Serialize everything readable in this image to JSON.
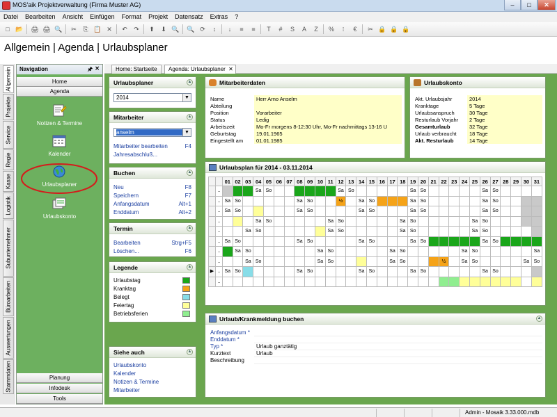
{
  "window": {
    "title": "MOS'aik Projektverwaltung (Firma Muster AG)",
    "minimize": "–",
    "maximize": "□",
    "close": "✕"
  },
  "menu": [
    "Datei",
    "Bearbeiten",
    "Ansicht",
    "Einfügen",
    "Format",
    "Projekt",
    "Datensatz",
    "Extras",
    "?"
  ],
  "toolbar": {
    "buttons": [
      "□",
      "📂",
      "🖨",
      "🖨",
      "🔍",
      "✂",
      "⎘",
      "📋",
      "✕",
      "↶",
      "↷",
      "⬆",
      "⬇",
      "🔍",
      "🔍",
      "⟳",
      "↕",
      "↓",
      "≡",
      "≡",
      "T",
      "#",
      "S",
      "A",
      "Z",
      "%",
      "⁝",
      "€",
      "✂",
      "🔒",
      "🔒",
      "🔒"
    ]
  },
  "breadcrumb": "Allgemein | Agenda | Urlaubsplaner",
  "sidetabs": [
    "Allgemein",
    "Projekte",
    "Service",
    "Regie",
    "Kasse",
    "Logistik",
    "Subunternehmer",
    "Büroarbeiten",
    "Auswertungen",
    "Stammdaten"
  ],
  "nav": {
    "title": "Navigation",
    "pin": "🖈",
    "close": "✕",
    "top_buttons": [
      "Home",
      "Agenda"
    ],
    "items": [
      "Notizen & Termine",
      "Kalender",
      "Urlaubsplaner",
      "Urlaubskonto"
    ],
    "bottom_buttons": [
      "Planung",
      "Infodesk",
      "Tools"
    ]
  },
  "tabs": {
    "home": "Home: Startseite",
    "agenda": "Agenda: Urlaubsplaner",
    "close": "✕"
  },
  "left": {
    "urlaubsplaner": {
      "title": "Urlaubsplaner",
      "year": "2014",
      "collapse": "▲"
    },
    "mitarbeiter": {
      "title": "Mitarbeiter",
      "selected": "anselm",
      "links": [
        {
          "label": "Mitarbeiter bearbeiten",
          "key": "F4"
        },
        {
          "label": "Jahresabschluß...",
          "key": ""
        }
      ]
    },
    "buchen": {
      "title": "Buchen",
      "links": [
        {
          "label": "Neu",
          "key": "F8"
        },
        {
          "label": "Speichern",
          "key": "F7"
        },
        {
          "label": "Anfangsdatum",
          "key": "Alt+1"
        },
        {
          "label": "Enddatum",
          "key": "Alt+2"
        }
      ]
    },
    "termin": {
      "title": "Termin",
      "links": [
        {
          "label": "Bearbeiten",
          "key": "Strg+F5"
        },
        {
          "label": "Löschen...",
          "key": "F6"
        }
      ]
    },
    "legende": {
      "title": "Legende",
      "items": [
        {
          "label": "Urlaubstag",
          "color": "#1aa61a"
        },
        {
          "label": "Kranktag",
          "color": "#f5a318"
        },
        {
          "label": "Belegt",
          "color": "#88dde8"
        },
        {
          "label": "Feiertag",
          "color": "#ffff99"
        },
        {
          "label": "Betriebsferien",
          "color": "#90ee90"
        }
      ]
    },
    "siehe": {
      "title": "Siehe auch",
      "links": [
        "Urlaubskonto",
        "Kalender",
        "Notizen & Termine",
        "Mitarbeiter"
      ]
    }
  },
  "mitarbeiterdaten": {
    "title": "Mitarbeiterdaten",
    "rows": [
      {
        "k": "Name",
        "v": "Herr Arno Anselm"
      },
      {
        "k": "Abteilung",
        "v": ""
      },
      {
        "k": "Position",
        "v": "Vorarbeiter"
      },
      {
        "k": "Status",
        "v": "Ledig"
      },
      {
        "k": "Arbeitszeit",
        "v": "Mo-Fr morgens 8-12:30 Uhr, Mo-Fr nachmittags 13-16 U"
      },
      {
        "k": "Geburtstag",
        "v": "19.01.1965"
      },
      {
        "k": "Eingestellt am",
        "v": "01.01.1985"
      }
    ]
  },
  "urlaubskonto": {
    "title": "Urlaubskonto",
    "rows": [
      {
        "k": "Akt. Urlaubsjahr",
        "v": "2014",
        "bold": false
      },
      {
        "k": "Kranktage",
        "v": "5 Tage",
        "bold": false
      },
      {
        "k": "Urlaubsanspruch",
        "v": "30 Tage",
        "bold": false
      },
      {
        "k": "Resturlaub Vorjahr",
        "v": "2 Tage",
        "bold": false
      },
      {
        "k": "Gesamturlaub",
        "v": "32 Tage",
        "bold": true
      },
      {
        "k": "Urlaub verbraucht",
        "v": "18 Tage",
        "bold": false
      },
      {
        "k": "Akt. Resturlaub",
        "v": "14 Tage",
        "bold": true
      }
    ]
  },
  "plan": {
    "title": "Urlaubsplan für 2014 - 03.11.2014",
    "days": [
      "01",
      "02",
      "03",
      "04",
      "05",
      "06",
      "07",
      "08",
      "09",
      "10",
      "11",
      "12",
      "13",
      "14",
      "15",
      "16",
      "17",
      "18",
      "19",
      "20",
      "21",
      "22",
      "23",
      "24",
      "25",
      "26",
      "27",
      "28",
      "29",
      "30",
      "31"
    ],
    "rows": [
      [
        "G",
        "U",
        "U",
        "Sa",
        "So",
        "",
        "",
        "U",
        "U",
        "U",
        "U",
        "Sa",
        "So",
        "",
        "",
        "",
        "",
        "",
        "Sa",
        "So",
        "",
        "",
        "",
        "",
        "",
        "Sa",
        "So",
        "",
        "",
        "",
        "",
        "W",
        "W"
      ],
      [
        "Sa",
        "So",
        "",
        "",
        "",
        "",
        "",
        "Sa",
        "So",
        "",
        "",
        "K½",
        "",
        "Sa",
        "So",
        "K",
        "K",
        "K",
        "Sa",
        "So",
        "",
        "",
        "",
        "",
        "",
        "Sa",
        "So",
        "",
        "",
        "G",
        "G"
      ],
      [
        "Sa",
        "So",
        "",
        "F",
        "",
        "",
        "",
        "Sa",
        "So",
        "",
        "",
        "",
        "",
        "Sa",
        "So",
        "",
        "",
        "",
        "Sa",
        "So",
        "",
        "",
        "",
        "",
        "",
        "Sa",
        "So",
        "",
        "",
        "G",
        "G"
      ],
      [
        "",
        "F",
        "",
        "Sa",
        "So",
        "",
        "",
        "",
        "",
        "",
        "Sa",
        "So",
        "",
        "",
        "",
        "",
        "",
        "Sa",
        "So",
        "",
        "",
        "",
        "",
        "",
        "Sa",
        "So",
        "",
        "",
        "",
        "G",
        "G"
      ],
      [
        "",
        "",
        "Sa",
        "So",
        "",
        "",
        "",
        "",
        "",
        "F",
        "Sa",
        "So",
        "",
        "",
        "",
        "",
        "",
        "Sa",
        "So",
        "",
        "",
        "",
        "",
        "",
        "Sa",
        "So",
        "",
        "",
        "",
        "",
        "G"
      ],
      [
        "Sa",
        "So",
        "",
        "",
        "",
        "",
        "",
        "Sa",
        "So",
        "",
        "",
        "",
        "",
        "Sa",
        "So",
        "",
        "",
        "",
        "Sa",
        "So",
        "U",
        "U",
        "U",
        "U",
        "U",
        "Sa",
        "So",
        "U",
        "U",
        "U",
        "U"
      ],
      [
        "U",
        "Sa",
        "So",
        "",
        "",
        "",
        "",
        "",
        "",
        "Sa",
        "So",
        "",
        "",
        "",
        "",
        "",
        "Sa",
        "So",
        "",
        "",
        "",
        "",
        "",
        "Sa",
        "So",
        "",
        "",
        "",
        "",
        "",
        "Sa"
      ],
      [
        "",
        "",
        "Sa",
        "So",
        "",
        "",
        "",
        "",
        "",
        "Sa",
        "So",
        "",
        "",
        "F",
        "",
        "",
        "Sa",
        "So",
        "",
        "",
        "K",
        "K½",
        "",
        "Sa",
        "So",
        "",
        "",
        "",
        "",
        "Sa",
        "So"
      ],
      [
        "Sa",
        "So",
        "B",
        "",
        "",
        "",
        "",
        "Sa",
        "So",
        "",
        "",
        "",
        "",
        "Sa",
        "So",
        "",
        "",
        "",
        "Sa",
        "So",
        "",
        "",
        "",
        "",
        "",
        "Sa",
        "So",
        "",
        "",
        "",
        "G"
      ],
      [
        "",
        "",
        "",
        "",
        "",
        "",
        "",
        "",
        "",
        "",
        "",
        "",
        "",
        "",
        "",
        "",
        "",
        "",
        "",
        "",
        "",
        "BF",
        "BF",
        "F",
        "F",
        "F",
        "F",
        "F",
        "F",
        "",
        "F"
      ]
    ],
    "row_markers": [
      "..",
      "..",
      "..",
      "..",
      "..",
      "..",
      "..",
      "..",
      "..",
      ".."
    ],
    "current_row": 8,
    "current_marker": "▶"
  },
  "buchung": {
    "title": "Urlaub/Krankmeldung buchen",
    "rows": [
      {
        "k": "Anfangsdatum *",
        "v": "",
        "req": true
      },
      {
        "k": "Enddatum *",
        "v": "",
        "req": true
      },
      {
        "k": "Typ *",
        "v": "Urlaub ganztätig",
        "req": true
      },
      {
        "k": "Kurztext",
        "v": "Urlaub",
        "req": false
      },
      {
        "k": "Beschreibung",
        "v": "",
        "req": false
      }
    ]
  },
  "status": {
    "right": "Admin - Mosaik 3.33.000.mdb"
  },
  "colors": {
    "urlaub": "#1aa61a",
    "krank": "#f5a318",
    "belegt": "#88dde8",
    "feiertag": "#ffff99",
    "betriebsferien": "#90ee90",
    "content_bg": "#6aa64e"
  }
}
